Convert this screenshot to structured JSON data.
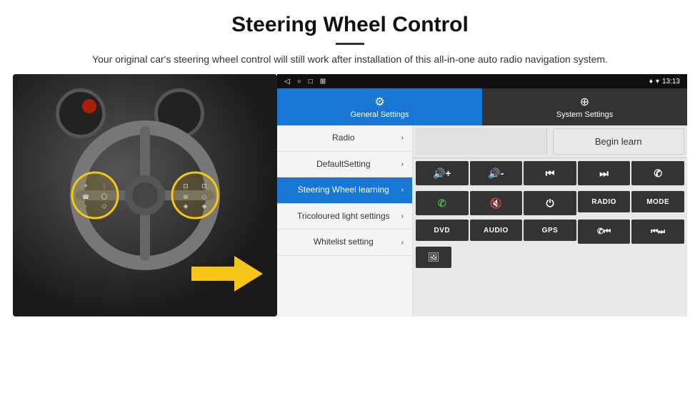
{
  "header": {
    "title": "Steering Wheel Control",
    "divider": true,
    "subtitle": "Your original car's steering wheel control will still work after installation of this all-in-one auto radio navigation system."
  },
  "android_ui": {
    "status_bar": {
      "left_icons": [
        "◁",
        "○",
        "□",
        "⊞"
      ],
      "right_text": "13:13",
      "signal_icons": "▾ ♦"
    },
    "tabs": [
      {
        "id": "general",
        "label": "General Settings",
        "icon": "⚙",
        "active": true
      },
      {
        "id": "system",
        "label": "System Settings",
        "icon": "🌐",
        "active": false
      }
    ],
    "menu_items": [
      {
        "id": "radio",
        "label": "Radio",
        "active": false
      },
      {
        "id": "default",
        "label": "DefaultSetting",
        "active": false
      },
      {
        "id": "steering",
        "label": "Steering Wheel learning",
        "active": true
      },
      {
        "id": "tricolour",
        "label": "Tricoloured light settings",
        "active": false
      },
      {
        "id": "whitelist",
        "label": "Whitelist setting",
        "active": false
      }
    ],
    "controls": {
      "begin_learn": "Begin learn",
      "grid_row1": [
        "🔊+",
        "🔊-",
        "⏮",
        "⏭",
        "📞"
      ],
      "grid_row2": [
        "📞",
        "🔇",
        "⏻",
        "RADIO",
        "MODE"
      ],
      "grid_row3": [
        "DVD",
        "AUDIO",
        "GPS",
        "📞⏮",
        "⏮⏭"
      ],
      "grid_row4": [
        "🖼"
      ]
    }
  },
  "icons": {
    "chevron": "›",
    "gear": "⚙",
    "globe": "⊕",
    "back": "◁",
    "home": "○",
    "recents": "□",
    "menu_squares": "⊞",
    "vol_up": "🔊+",
    "vol_down": "🔊-",
    "prev": "⏮",
    "next": "⏭",
    "phone": "✆",
    "answer": "✆",
    "mute": "🔇",
    "power": "⏻",
    "radio": "RADIO",
    "mode": "MODE",
    "dvd": "DVD",
    "audio": "AUDIO",
    "gps": "GPS",
    "image": "🖼"
  }
}
